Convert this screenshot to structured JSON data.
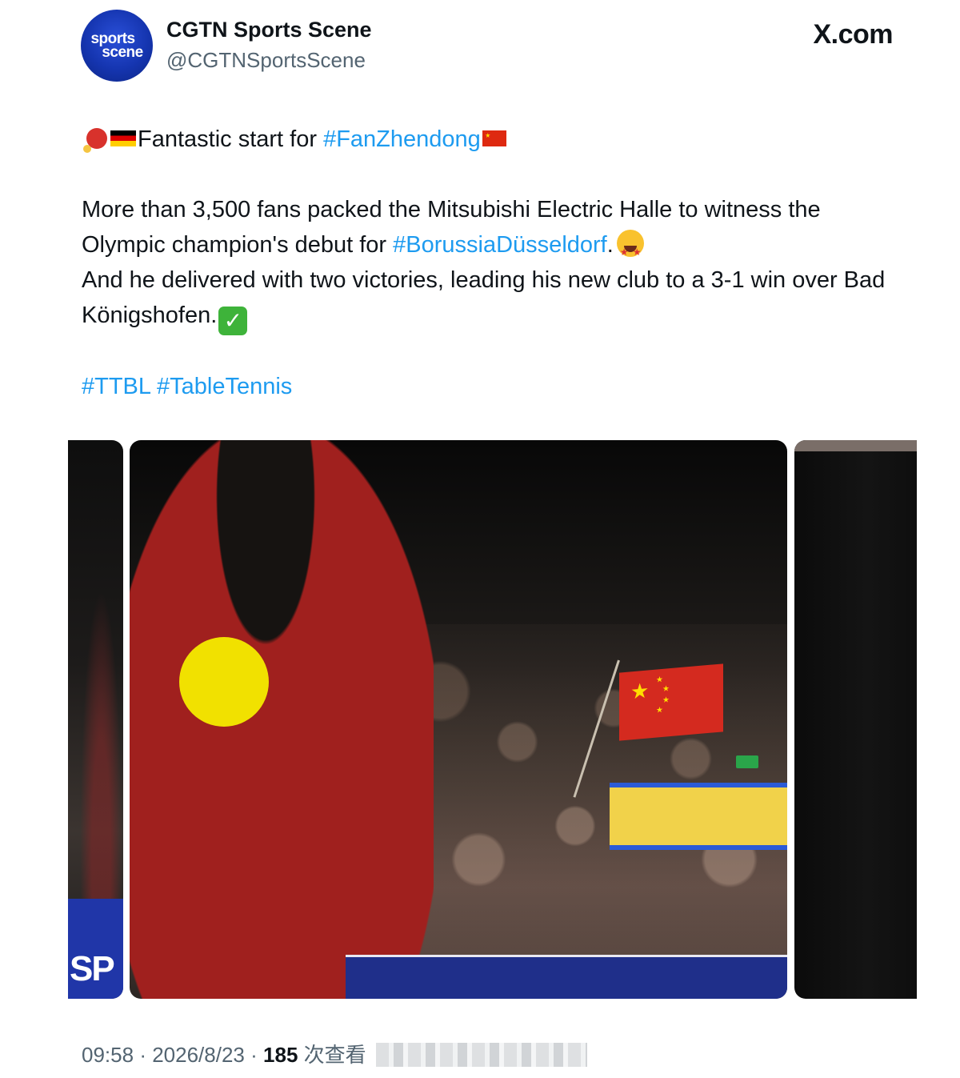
{
  "post": {
    "avatar_text": [
      "sports",
      "scene"
    ],
    "display_name": "CGTN Sports Scene",
    "handle": "@CGTNSportsScene",
    "site_logo": "X.com",
    "line1_text": "Fantastic start for ",
    "line1_hashtag": "#FanZhendong",
    "para_part1": "More than 3,500 fans packed the Mitsubishi Electric Halle to witness the Olympic champion's debut for ",
    "para_hashtag": "#BorussiaDüsseldorf",
    "para_part2": ".",
    "para_part3": "And he delivered with two victories, leading his new club to a 3-1 win over Bad Königshofen.",
    "tags_line": "#TTBL #TableTennis",
    "emojis": [
      "ping-pong-paddle-icon",
      "germany-flag-icon",
      "china-flag-icon",
      "star-struck-icon",
      "check-mark-icon"
    ]
  },
  "media": {
    "count_visible": 3,
    "colors": {
      "jersey": "#a0201e",
      "patch": "#f1e100",
      "banner": "#f1d24a",
      "table": "#1f2f8a",
      "flag": "#d42a1f"
    }
  },
  "meta": {
    "time": "09:58",
    "date": "2026/8/23",
    "views": "185",
    "views_label": "次查看"
  },
  "colors": {
    "link": "#1d9bf0",
    "text": "#0f1419",
    "muted": "#536471"
  }
}
